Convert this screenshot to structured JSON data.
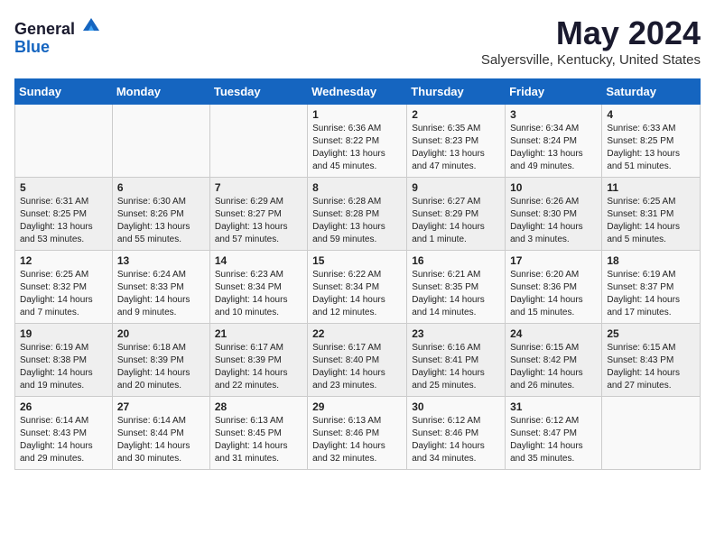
{
  "header": {
    "logo_general": "General",
    "logo_blue": "Blue",
    "title": "May 2024",
    "subtitle": "Salyersville, Kentucky, United States"
  },
  "days_of_week": [
    "Sunday",
    "Monday",
    "Tuesday",
    "Wednesday",
    "Thursday",
    "Friday",
    "Saturday"
  ],
  "weeks": [
    [
      {
        "day": "",
        "sunrise": "",
        "sunset": "",
        "daylight": ""
      },
      {
        "day": "",
        "sunrise": "",
        "sunset": "",
        "daylight": ""
      },
      {
        "day": "",
        "sunrise": "",
        "sunset": "",
        "daylight": ""
      },
      {
        "day": "1",
        "sunrise": "Sunrise: 6:36 AM",
        "sunset": "Sunset: 8:22 PM",
        "daylight": "Daylight: 13 hours and 45 minutes."
      },
      {
        "day": "2",
        "sunrise": "Sunrise: 6:35 AM",
        "sunset": "Sunset: 8:23 PM",
        "daylight": "Daylight: 13 hours and 47 minutes."
      },
      {
        "day": "3",
        "sunrise": "Sunrise: 6:34 AM",
        "sunset": "Sunset: 8:24 PM",
        "daylight": "Daylight: 13 hours and 49 minutes."
      },
      {
        "day": "4",
        "sunrise": "Sunrise: 6:33 AM",
        "sunset": "Sunset: 8:25 PM",
        "daylight": "Daylight: 13 hours and 51 minutes."
      }
    ],
    [
      {
        "day": "5",
        "sunrise": "Sunrise: 6:31 AM",
        "sunset": "Sunset: 8:25 PM",
        "daylight": "Daylight: 13 hours and 53 minutes."
      },
      {
        "day": "6",
        "sunrise": "Sunrise: 6:30 AM",
        "sunset": "Sunset: 8:26 PM",
        "daylight": "Daylight: 13 hours and 55 minutes."
      },
      {
        "day": "7",
        "sunrise": "Sunrise: 6:29 AM",
        "sunset": "Sunset: 8:27 PM",
        "daylight": "Daylight: 13 hours and 57 minutes."
      },
      {
        "day": "8",
        "sunrise": "Sunrise: 6:28 AM",
        "sunset": "Sunset: 8:28 PM",
        "daylight": "Daylight: 13 hours and 59 minutes."
      },
      {
        "day": "9",
        "sunrise": "Sunrise: 6:27 AM",
        "sunset": "Sunset: 8:29 PM",
        "daylight": "Daylight: 14 hours and 1 minute."
      },
      {
        "day": "10",
        "sunrise": "Sunrise: 6:26 AM",
        "sunset": "Sunset: 8:30 PM",
        "daylight": "Daylight: 14 hours and 3 minutes."
      },
      {
        "day": "11",
        "sunrise": "Sunrise: 6:25 AM",
        "sunset": "Sunset: 8:31 PM",
        "daylight": "Daylight: 14 hours and 5 minutes."
      }
    ],
    [
      {
        "day": "12",
        "sunrise": "Sunrise: 6:25 AM",
        "sunset": "Sunset: 8:32 PM",
        "daylight": "Daylight: 14 hours and 7 minutes."
      },
      {
        "day": "13",
        "sunrise": "Sunrise: 6:24 AM",
        "sunset": "Sunset: 8:33 PM",
        "daylight": "Daylight: 14 hours and 9 minutes."
      },
      {
        "day": "14",
        "sunrise": "Sunrise: 6:23 AM",
        "sunset": "Sunset: 8:34 PM",
        "daylight": "Daylight: 14 hours and 10 minutes."
      },
      {
        "day": "15",
        "sunrise": "Sunrise: 6:22 AM",
        "sunset": "Sunset: 8:34 PM",
        "daylight": "Daylight: 14 hours and 12 minutes."
      },
      {
        "day": "16",
        "sunrise": "Sunrise: 6:21 AM",
        "sunset": "Sunset: 8:35 PM",
        "daylight": "Daylight: 14 hours and 14 minutes."
      },
      {
        "day": "17",
        "sunrise": "Sunrise: 6:20 AM",
        "sunset": "Sunset: 8:36 PM",
        "daylight": "Daylight: 14 hours and 15 minutes."
      },
      {
        "day": "18",
        "sunrise": "Sunrise: 6:19 AM",
        "sunset": "Sunset: 8:37 PM",
        "daylight": "Daylight: 14 hours and 17 minutes."
      }
    ],
    [
      {
        "day": "19",
        "sunrise": "Sunrise: 6:19 AM",
        "sunset": "Sunset: 8:38 PM",
        "daylight": "Daylight: 14 hours and 19 minutes."
      },
      {
        "day": "20",
        "sunrise": "Sunrise: 6:18 AM",
        "sunset": "Sunset: 8:39 PM",
        "daylight": "Daylight: 14 hours and 20 minutes."
      },
      {
        "day": "21",
        "sunrise": "Sunrise: 6:17 AM",
        "sunset": "Sunset: 8:39 PM",
        "daylight": "Daylight: 14 hours and 22 minutes."
      },
      {
        "day": "22",
        "sunrise": "Sunrise: 6:17 AM",
        "sunset": "Sunset: 8:40 PM",
        "daylight": "Daylight: 14 hours and 23 minutes."
      },
      {
        "day": "23",
        "sunrise": "Sunrise: 6:16 AM",
        "sunset": "Sunset: 8:41 PM",
        "daylight": "Daylight: 14 hours and 25 minutes."
      },
      {
        "day": "24",
        "sunrise": "Sunrise: 6:15 AM",
        "sunset": "Sunset: 8:42 PM",
        "daylight": "Daylight: 14 hours and 26 minutes."
      },
      {
        "day": "25",
        "sunrise": "Sunrise: 6:15 AM",
        "sunset": "Sunset: 8:43 PM",
        "daylight": "Daylight: 14 hours and 27 minutes."
      }
    ],
    [
      {
        "day": "26",
        "sunrise": "Sunrise: 6:14 AM",
        "sunset": "Sunset: 8:43 PM",
        "daylight": "Daylight: 14 hours and 29 minutes."
      },
      {
        "day": "27",
        "sunrise": "Sunrise: 6:14 AM",
        "sunset": "Sunset: 8:44 PM",
        "daylight": "Daylight: 14 hours and 30 minutes."
      },
      {
        "day": "28",
        "sunrise": "Sunrise: 6:13 AM",
        "sunset": "Sunset: 8:45 PM",
        "daylight": "Daylight: 14 hours and 31 minutes."
      },
      {
        "day": "29",
        "sunrise": "Sunrise: 6:13 AM",
        "sunset": "Sunset: 8:46 PM",
        "daylight": "Daylight: 14 hours and 32 minutes."
      },
      {
        "day": "30",
        "sunrise": "Sunrise: 6:12 AM",
        "sunset": "Sunset: 8:46 PM",
        "daylight": "Daylight: 14 hours and 34 minutes."
      },
      {
        "day": "31",
        "sunrise": "Sunrise: 6:12 AM",
        "sunset": "Sunset: 8:47 PM",
        "daylight": "Daylight: 14 hours and 35 minutes."
      },
      {
        "day": "",
        "sunrise": "",
        "sunset": "",
        "daylight": ""
      }
    ]
  ]
}
